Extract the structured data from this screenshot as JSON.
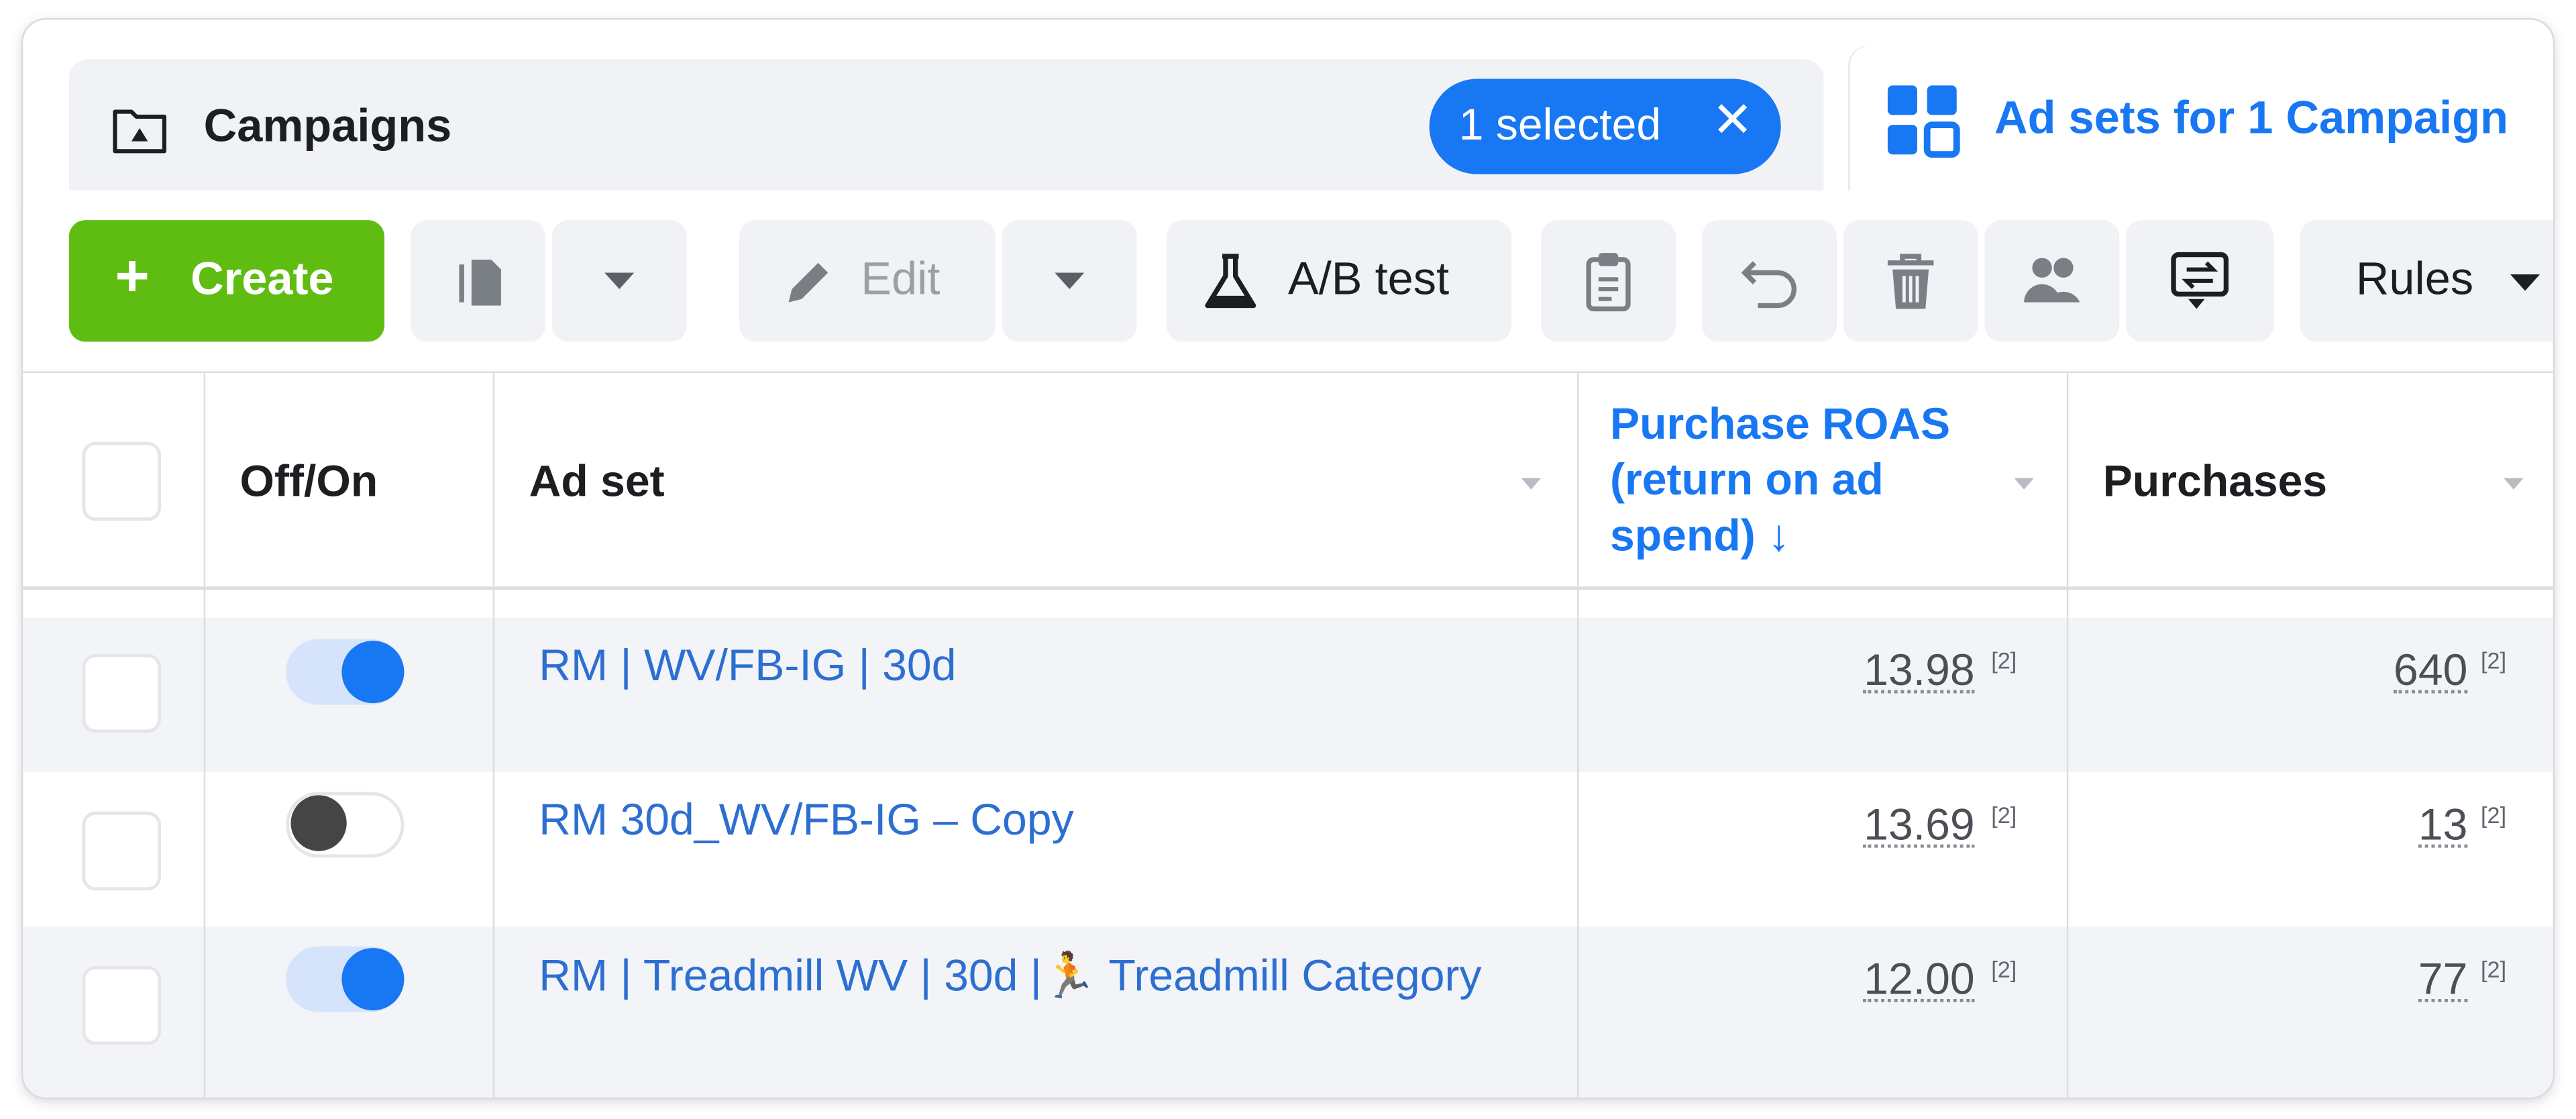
{
  "tabs": {
    "campaigns": {
      "title": "Campaigns",
      "selected_pill": "1 selected",
      "clear_icon": "close-icon"
    },
    "adsets": {
      "title": "Ad sets for 1 Campaign"
    }
  },
  "toolbar": {
    "create_label": "Create",
    "create_icon": "plus-icon",
    "edit_label": "Edit",
    "ab_test_label": "A/B test",
    "rules_label": "Rules",
    "icons": [
      "duplicate-icon",
      "chevron-down-icon",
      "pencil-icon",
      "flask-icon",
      "clipboard-icon",
      "undo-icon",
      "trash-icon",
      "people-icon",
      "compare-icon"
    ]
  },
  "table": {
    "columns": {
      "toggle": "Off/On",
      "adset": "Ad set",
      "roas_line1": "Purchase ROAS",
      "roas_line2": "(return on ad",
      "roas_line3": "spend) ↓",
      "purchases": "Purchases"
    },
    "rows": [
      {
        "on": true,
        "name": "RM | WV/FB-IG | 30d",
        "roas": "13.98",
        "roas_note": "[2]",
        "purchases": "640",
        "purchases_note": "[2]"
      },
      {
        "on": false,
        "name": "RM 30d_WV/FB-IG – Copy",
        "roas": "13.69",
        "roas_note": "[2]",
        "purchases": "13",
        "purchases_note": "[2]"
      },
      {
        "on": true,
        "name": "RM | Treadmill WV | 30d |🏃 Treadmill Category",
        "roas": "12.00",
        "roas_note": "[2]",
        "purchases": "77",
        "purchases_note": "[2]"
      }
    ]
  },
  "colors": {
    "accent": "#1877f2",
    "create": "#5fbd12",
    "link": "#2d6fd1",
    "row_shade": "#f2f4f7"
  }
}
